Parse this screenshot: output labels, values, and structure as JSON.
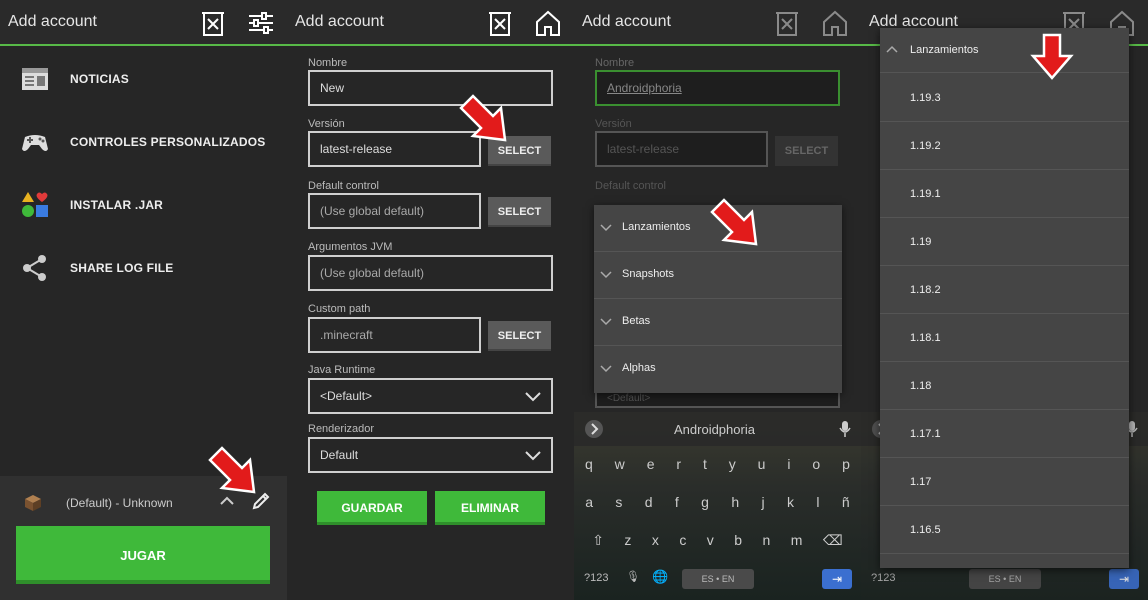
{
  "colors": {
    "accent": "#57b947",
    "button_green": "#3fb93a",
    "arrow_red": "#e21b1b"
  },
  "panel1": {
    "title": "Add account",
    "menu": [
      {
        "label": "NOTICIAS",
        "icon": "news-icon"
      },
      {
        "label": "CONTROLES PERSONALIZADOS",
        "icon": "gamepad-icon"
      },
      {
        "label": "INSTALAR .JAR",
        "icon": "shapes-icon"
      },
      {
        "label": "SHARE LOG FILE",
        "icon": "share-icon"
      }
    ],
    "profile": {
      "name": "(Default) - Unknown"
    },
    "play_label": "JUGAR"
  },
  "panel2": {
    "title": "Add account",
    "fields": {
      "nombre": {
        "label": "Nombre",
        "value": "New"
      },
      "version": {
        "label": "Versión",
        "value": "latest-release",
        "button": "SELECT"
      },
      "control": {
        "label": "Default control",
        "placeholder": "(Use global default)",
        "button": "SELECT"
      },
      "jvm": {
        "label": "Argumentos JVM",
        "placeholder": "(Use global default)"
      },
      "path": {
        "label": "Custom path",
        "placeholder": ".minecraft",
        "button": "SELECT"
      },
      "java": {
        "label": "Java Runtime",
        "value": "<Default>"
      },
      "render": {
        "label": "Renderizador",
        "value": "Default"
      }
    },
    "save_label": "GUARDAR",
    "delete_label": "ELIMINAR"
  },
  "panel3": {
    "title": "Add account",
    "nombre_label": "Nombre",
    "nombre_value": "Androidphoria",
    "version_label": "Versión",
    "version_value": "latest-release",
    "select_label": "SELECT",
    "control_label": "Default control",
    "java_value": "<Default>",
    "categories": [
      "Lanzamientos",
      "Snapshots",
      "Betas",
      "Alphas"
    ]
  },
  "keyboard": {
    "suggestion": "Androidphoria",
    "row1": [
      "q",
      "w",
      "e",
      "r",
      "t",
      "y",
      "u",
      "i",
      "o",
      "p"
    ],
    "row2": [
      "a",
      "s",
      "d",
      "f",
      "g",
      "h",
      "j",
      "k",
      "l",
      "ñ"
    ],
    "row3": [
      "z",
      "x",
      "c",
      "v",
      "b",
      "n",
      "m"
    ],
    "symbols_key": "?123",
    "space_label": "ES • EN"
  },
  "panel4": {
    "title": "Add account",
    "category": "Lanzamientos",
    "versions": [
      "1.19.3",
      "1.19.2",
      "1.19.1",
      "1.19",
      "1.18.2",
      "1.18.1",
      "1.18",
      "1.17.1",
      "1.17",
      "1.16.5"
    ]
  }
}
